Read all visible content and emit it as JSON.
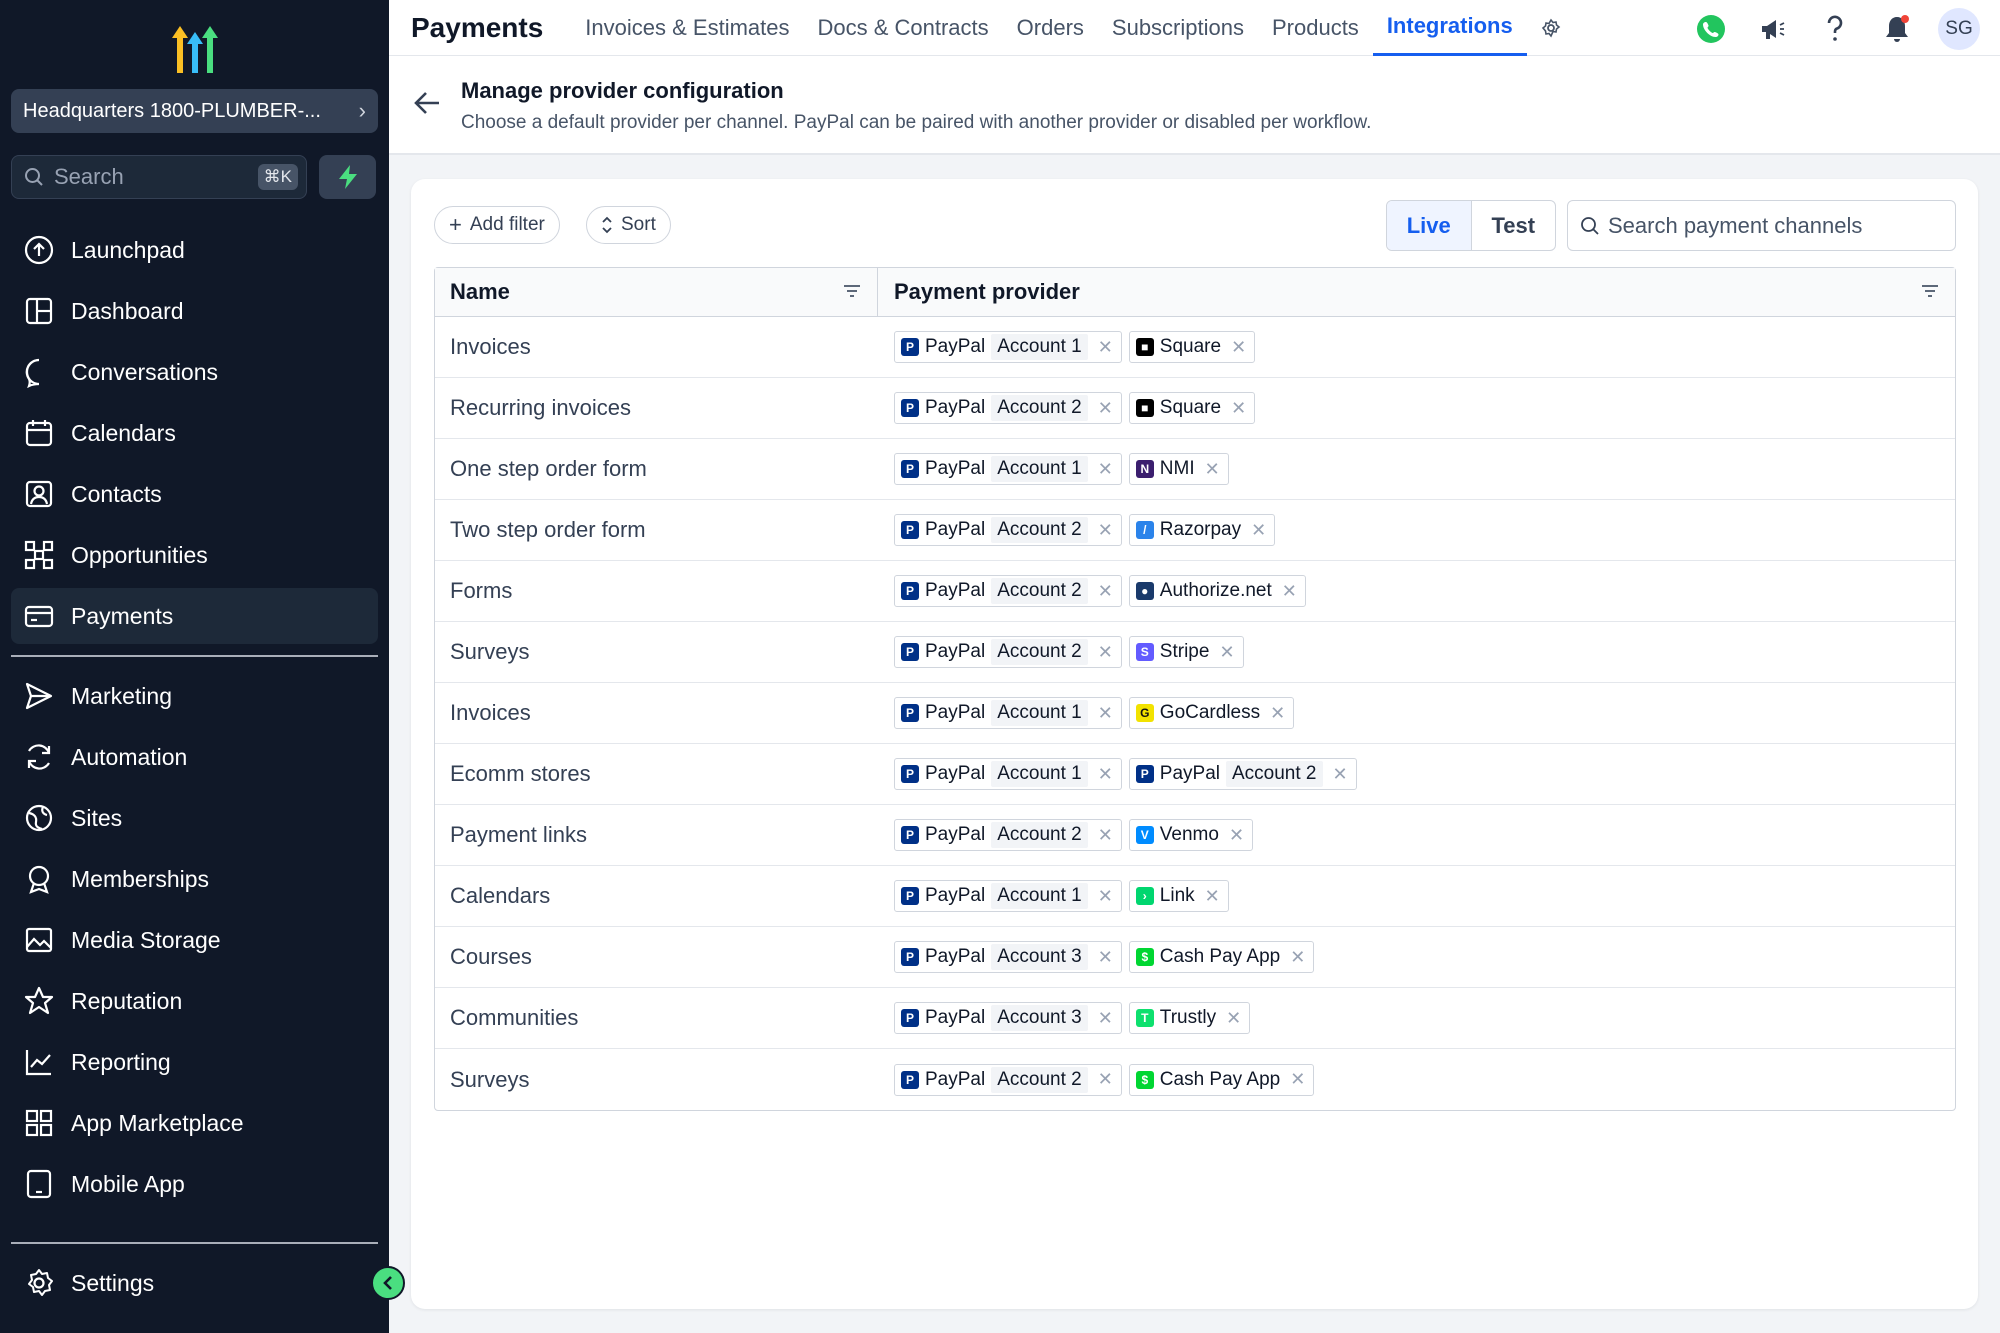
{
  "sidebar": {
    "location": "Headquarters 1800-PLUMBER-...",
    "search_placeholder": "Search",
    "shortcut": "⌘K",
    "nav_top": [
      {
        "label": "Launchpad",
        "icon": "launchpad-icon"
      },
      {
        "label": "Dashboard",
        "icon": "dashboard-icon"
      },
      {
        "label": "Conversations",
        "icon": "chat-icon"
      },
      {
        "label": "Calendars",
        "icon": "calendar-icon"
      },
      {
        "label": "Contacts",
        "icon": "contacts-icon"
      },
      {
        "label": "Opportunities",
        "icon": "opportunities-icon"
      },
      {
        "label": "Payments",
        "icon": "card-icon",
        "active": true
      }
    ],
    "nav_bottom": [
      {
        "label": "Marketing",
        "icon": "send-icon"
      },
      {
        "label": "Automation",
        "icon": "refresh-icon"
      },
      {
        "label": "Sites",
        "icon": "globe-icon"
      },
      {
        "label": "Memberships",
        "icon": "award-icon"
      },
      {
        "label": "Media Storage",
        "icon": "image-icon"
      },
      {
        "label": "Reputation",
        "icon": "star-icon"
      },
      {
        "label": "Reporting",
        "icon": "chart-icon"
      },
      {
        "label": "App Marketplace",
        "icon": "grid-icon"
      },
      {
        "label": "Mobile App",
        "icon": "tablet-icon"
      }
    ],
    "settings_label": "Settings"
  },
  "topbar": {
    "title": "Payments",
    "tabs": [
      "Invoices & Estimates",
      "Docs & Contracts",
      "Orders",
      "Subscriptions",
      "Products",
      "Integrations"
    ],
    "active_tab": "Integrations",
    "avatar_initials": "SG"
  },
  "header": {
    "title": "Manage provider configuration",
    "subtitle": "Choose a default provider per channel. PayPal can be paired with another provider or disabled per workflow."
  },
  "toolbar": {
    "add_filter": "Add filter",
    "sort": "Sort",
    "mode_live": "Live",
    "mode_test": "Test",
    "search_placeholder": "Search payment channels"
  },
  "table": {
    "columns": [
      "Name",
      "Payment provider"
    ],
    "rows": [
      {
        "name": "Invoices",
        "paypal_account": "Account 1",
        "provider": "Square"
      },
      {
        "name": "Recurring invoices",
        "paypal_account": "Account 2",
        "provider": "Square"
      },
      {
        "name": "One step order form",
        "paypal_account": "Account 1",
        "provider": "NMI"
      },
      {
        "name": "Two step order form",
        "paypal_account": "Account 2",
        "provider": "Razorpay"
      },
      {
        "name": "Forms",
        "paypal_account": "Account 2",
        "provider": "Authorize.net"
      },
      {
        "name": "Surveys",
        "paypal_account": "Account 2",
        "provider": "Stripe"
      },
      {
        "name": "Invoices",
        "paypal_account": "Account 1",
        "provider": "GoCardless"
      },
      {
        "name": "Ecomm stores",
        "paypal_account": "Account 1",
        "provider": "PayPal",
        "provider_account": "Account 2"
      },
      {
        "name": "Payment links",
        "paypal_account": "Account 2",
        "provider": "Venmo"
      },
      {
        "name": "Calendars",
        "paypal_account": "Account 1",
        "provider": "Link"
      },
      {
        "name": "Courses",
        "paypal_account": "Account 3",
        "provider": "Cash Pay App"
      },
      {
        "name": "Communities",
        "paypal_account": "Account 3",
        "provider": "Trustly"
      },
      {
        "name": "Surveys",
        "paypal_account": "Account 2",
        "provider": "Cash Pay App"
      }
    ],
    "paypal_label": "PayPal"
  },
  "provider_colors": {
    "Square": "#000000",
    "NMI": "#3b1e6e",
    "Razorpay": "#2b83ea",
    "Authorize.net": "#1a3a6b",
    "Stripe": "#635bff",
    "GoCardless": "#f2e200",
    "PayPal": "#003087",
    "Venmo": "#008cff",
    "Link": "#00d66f",
    "Cash Pay App": "#00d632",
    "Trustly": "#0ee06e"
  }
}
